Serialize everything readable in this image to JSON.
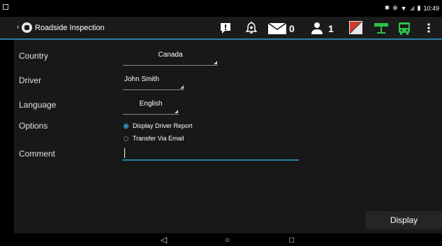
{
  "status_bar": {
    "time": "10:49",
    "icons": [
      "notification-icon",
      "bluetooth-icon",
      "vibrate-icon",
      "wifi-icon",
      "signal-icon",
      "battery-icon"
    ]
  },
  "action_bar": {
    "title": "Roadside Inspection",
    "icons": [
      "alert-icon",
      "bell-plus-icon",
      "mail-icon",
      "person-icon",
      "flag-icon",
      "signpost-icon",
      "bus-icon",
      "overflow-menu-icon"
    ],
    "mail_count": "0",
    "person_count": "1",
    "accent_color": "#2a7fa6"
  },
  "form": {
    "country_label": "Country",
    "country_value": "Canada",
    "driver_label": "Driver",
    "driver_value": "John Smith",
    "language_label": "Language",
    "language_value": "English",
    "options_label": "Options",
    "option_1": "Display Driver Report",
    "option_2": "Transfer Via Email",
    "selected_option": "Display Driver Report",
    "comment_label": "Comment",
    "comment_value": ""
  },
  "footer": {
    "display_label": "Display"
  },
  "nav_bar": {
    "icons": [
      "back-icon",
      "home-icon",
      "recents-icon"
    ],
    "back": "◁",
    "home": "○",
    "recents": "□"
  }
}
